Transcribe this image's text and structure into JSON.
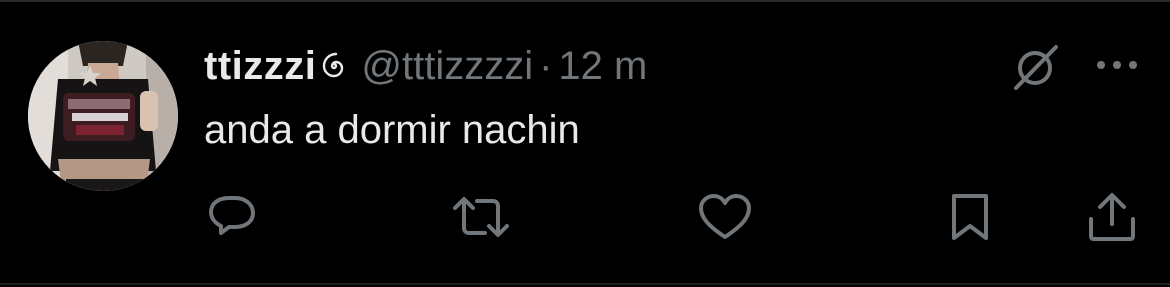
{
  "tweet": {
    "display_name": "ttizzzi",
    "handle": "@tttizzzzi",
    "separator": "·",
    "time": "12 m",
    "text": "anda a dormir nachin"
  },
  "icons": {
    "verified_like": "spiral-icon",
    "grok": "grok-icon",
    "more": "more-icon",
    "reply": "reply-icon",
    "retweet": "retweet-icon",
    "like": "heart-icon",
    "bookmark": "bookmark-icon",
    "share": "share-icon"
  },
  "colors": {
    "background": "#000000",
    "primary_text": "#e7e9ea",
    "secondary_text": "#71767b"
  }
}
